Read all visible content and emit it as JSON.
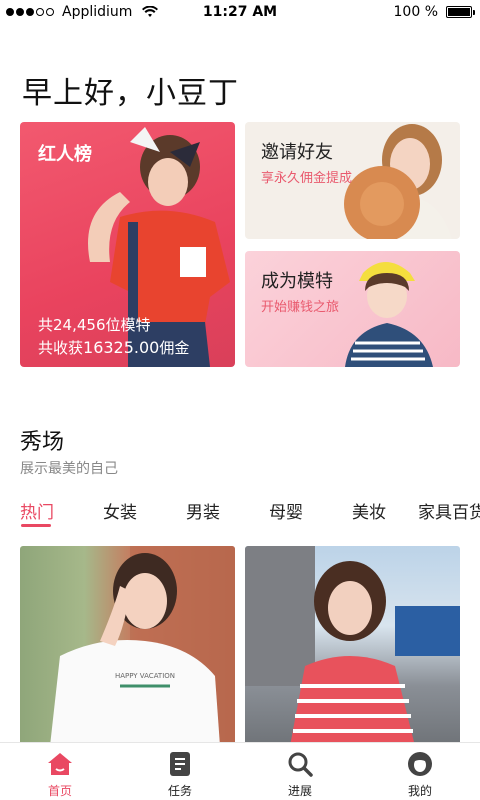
{
  "status_bar": {
    "carrier": "Applidium",
    "time": "11:27 AM",
    "battery_text": "100 %",
    "battery_level": 1.0,
    "signal_bars_filled": 3,
    "signal_bars_total": 5
  },
  "greeting": "早上好，小豆丁",
  "cards": {
    "ranking": {
      "title": "红人榜",
      "models_line": "共24,456位模特",
      "commission_prefix": "共收获",
      "commission_value": "16325.00",
      "commission_suffix": "佣金"
    },
    "invite": {
      "title": "邀请好友",
      "subtitle": "享永久佣金提成"
    },
    "become_model": {
      "title": "成为模特",
      "subtitle": "开始赚钱之旅"
    }
  },
  "section": {
    "title": "秀场",
    "subtitle": "展示最美的自己"
  },
  "tabs": [
    {
      "label": "热门",
      "active": true
    },
    {
      "label": "女装",
      "active": false
    },
    {
      "label": "男装",
      "active": false
    },
    {
      "label": "母婴",
      "active": false
    },
    {
      "label": "美妆",
      "active": false
    },
    {
      "label": "家具百货",
      "active": false
    }
  ],
  "bottom_nav": [
    {
      "label": "首页",
      "icon": "home-icon",
      "active": true
    },
    {
      "label": "任务",
      "icon": "task-icon",
      "active": false
    },
    {
      "label": "进展",
      "icon": "search-icon",
      "active": false
    },
    {
      "label": "我的",
      "icon": "profile-icon",
      "active": false
    }
  ],
  "colors": {
    "accent": "#e94862",
    "card_red": "#ea4760",
    "card_beige": "#f4efe9",
    "card_pink": "#f9c6d0"
  }
}
